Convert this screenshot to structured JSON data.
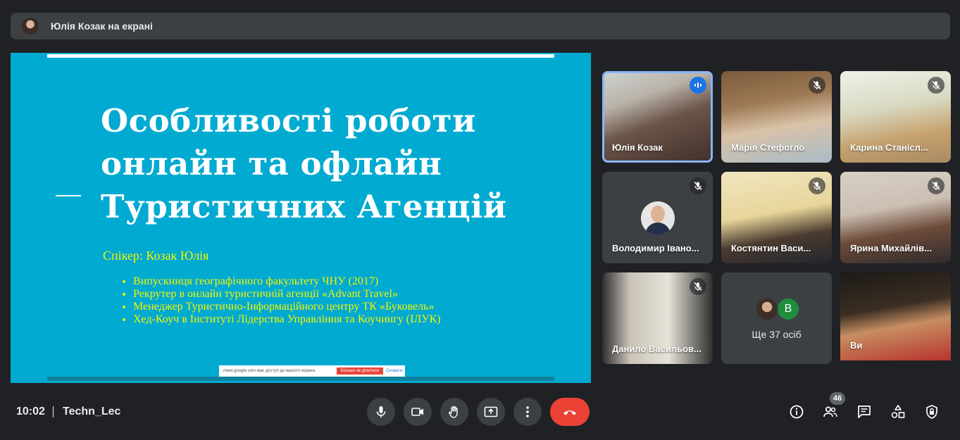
{
  "banner": {
    "text": "Юлія Козак на екрані"
  },
  "slide": {
    "title_lines": [
      "Особливості роботи",
      "онлайн та офлайн",
      "Туристичних Агенцій"
    ],
    "speaker": "Спікер: Козак Юлія",
    "bullets": [
      "Випускниця географічного факультету ЧНУ (2017)",
      "Рекрутер в онлайн туристичній агенції «Advant Travel»",
      "Менеджер Туристично-Інформаційного центру ТК «Буковель»",
      "Хед-Коуч в Інституті Лідерства Управління та Коучингу (ІЛУК)"
    ],
    "share_bar": {
      "text": "meet.google.com має доступ до вашого екрана.",
      "stop": "Більше не ділитися",
      "hide": "Сховати"
    }
  },
  "participants": [
    {
      "name": "Юлія Козак",
      "speaking": true
    },
    {
      "name": "Марія Стефогло",
      "muted": true
    },
    {
      "name": "Карина Станісл...",
      "muted": true
    },
    {
      "name": "Володимир Івано...",
      "muted": true
    },
    {
      "name": "Костянтин Вaси...",
      "muted": true
    },
    {
      "name": "Ярина Михайлів...",
      "muted": true
    },
    {
      "name": "Данило Васильов...",
      "muted": true
    },
    {
      "name": "Ви"
    }
  ],
  "more": {
    "avatar_letter": "B",
    "count_text": "Ще 37 осіб"
  },
  "bottom": {
    "time": "10:02",
    "meeting": "Techn_Lec",
    "participants_badge": "46"
  },
  "colors": {
    "slide_bg": "#00aad1",
    "slide_text": "#f5f500",
    "end_call": "#ea4335",
    "active_border": "#8ab4f8"
  }
}
